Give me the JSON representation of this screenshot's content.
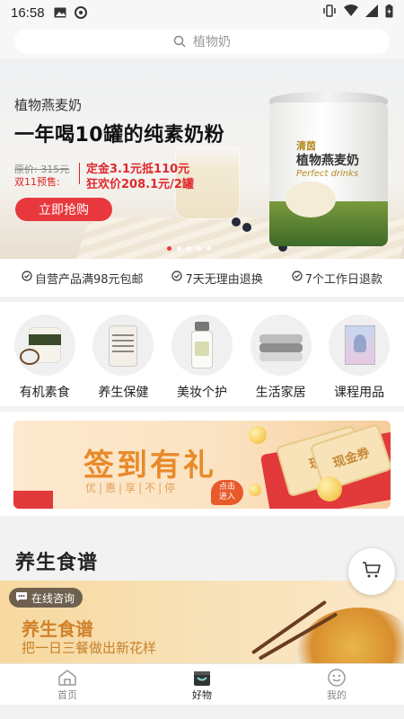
{
  "status": {
    "time": "16:58",
    "left_icons": [
      "image-icon",
      "sync-icon"
    ],
    "right_icons": [
      "vibrate-icon",
      "wifi-icon",
      "signal-icon",
      "battery-icon"
    ]
  },
  "search": {
    "placeholder": "植物奶"
  },
  "banner": {
    "subtitle": "植物燕麦奶",
    "headline": "一年喝10罐的纯素奶粉",
    "original_price": "原价: 315元",
    "presale": "双11预售:",
    "deposit": "定金3.1元抵110元",
    "carnival_price": "狂欢价208.1元/2罐",
    "cta": "立即抢购",
    "can_brand": "清茵",
    "can_product": "植物燕麦奶",
    "can_en": "Perfect drinks",
    "dots": 5,
    "active_dot": 0
  },
  "guarantees": [
    "自营产品满98元包邮",
    "7天无理由退换",
    "7个工作日退款"
  ],
  "categories": [
    {
      "label": "有机素食",
      "icon": "coconut-jar-icon"
    },
    {
      "label": "养生保健",
      "icon": "tea-can-icon"
    },
    {
      "label": "美妆个护",
      "icon": "bottle-icon"
    },
    {
      "label": "生活家居",
      "icon": "towels-icon"
    },
    {
      "label": "课程用品",
      "icon": "yoga-book-icon"
    }
  ],
  "signin": {
    "title": "签到有礼",
    "slogan": "优|惠|享|不|停",
    "enter_line1": "点击",
    "enter_line2": "进入",
    "coupon1": "现金",
    "coupon2": "现金券"
  },
  "recipes": {
    "heading": "养生食谱",
    "banner_title": "养生食谱",
    "banner_subtitle": "把一日三餐做出新花样",
    "consult": "在线咨询"
  },
  "nav": [
    {
      "label": "首页",
      "icon": "home-icon",
      "active": false
    },
    {
      "label": "好物",
      "icon": "shop-icon",
      "active": true
    },
    {
      "label": "我的",
      "icon": "smile-icon",
      "active": false
    }
  ]
}
